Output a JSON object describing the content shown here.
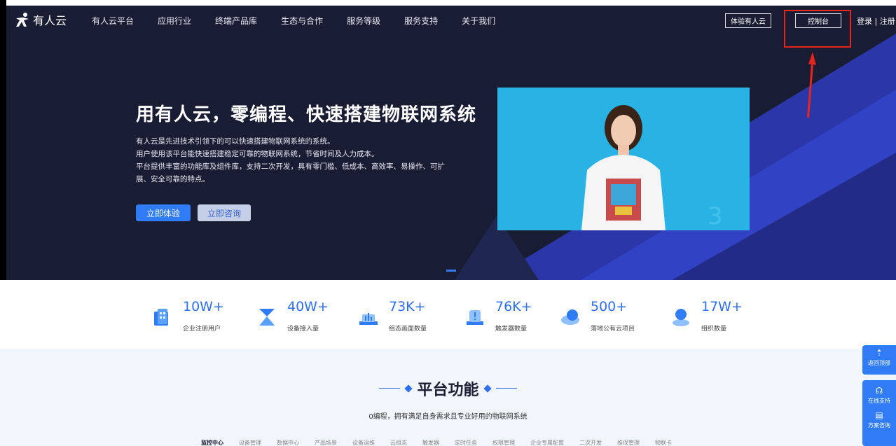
{
  "brand": {
    "name": "有人云"
  },
  "nav": {
    "items": [
      "有人云平台",
      "应用行业",
      "终端产品库",
      "生态与合作",
      "服务等级",
      "服务支持",
      "关于我们"
    ],
    "try_label": "体验有人云",
    "console_label": "控制台",
    "login_label": "登录 | 注册"
  },
  "hero": {
    "title": "用有人云，零编程、快速搭建物联网系统",
    "desc_lines": [
      "有人云是先进技术引领下的可以快速搭建物联网系统的系统。",
      "用户使用该平台能快速搭建稳定可靠的物联网系统，节省时间及人力成本。",
      "平台提供丰富的功能库及组件库，支持二次开发，具有零门槛、低成本、高效率、易操作、可扩",
      "展、安全可靠的特点。"
    ],
    "primary_button": "立即体验",
    "secondary_button": "立即咨询"
  },
  "stats": [
    {
      "value": "10W+",
      "label": "企业注册用户",
      "icon": "building-icon"
    },
    {
      "value": "40W+",
      "label": "设备接入量",
      "icon": "hourglass-icon"
    },
    {
      "value": "73K+",
      "label": "组态画面数量",
      "icon": "chart-icon"
    },
    {
      "value": "76K+",
      "label": "触发器数量",
      "icon": "alert-icon"
    },
    {
      "value": "500+",
      "label": "落地公有云项目",
      "icon": "cloud-icon"
    },
    {
      "value": "17W+",
      "label": "组织数量",
      "icon": "user-icon"
    }
  ],
  "platform": {
    "title": "平台功能",
    "subtitle": "0编程，拥有满足自身需求且专业好用的物联网系统",
    "tabs": [
      "监控中心",
      "设备管理",
      "数据中心",
      "产品场景",
      "设备运维",
      "云组态",
      "触发器",
      "定时任务",
      "权限管理",
      "企业专属配置",
      "二次开发",
      "维保管理",
      "物联卡"
    ]
  },
  "floating": {
    "back_top": "返回顶部",
    "online_support": "在线支持",
    "plan_consult": "方案咨询"
  },
  "colors": {
    "accent": "#2f7cf6",
    "hero_bg": "#181d34",
    "highlight": "#e8241b"
  }
}
